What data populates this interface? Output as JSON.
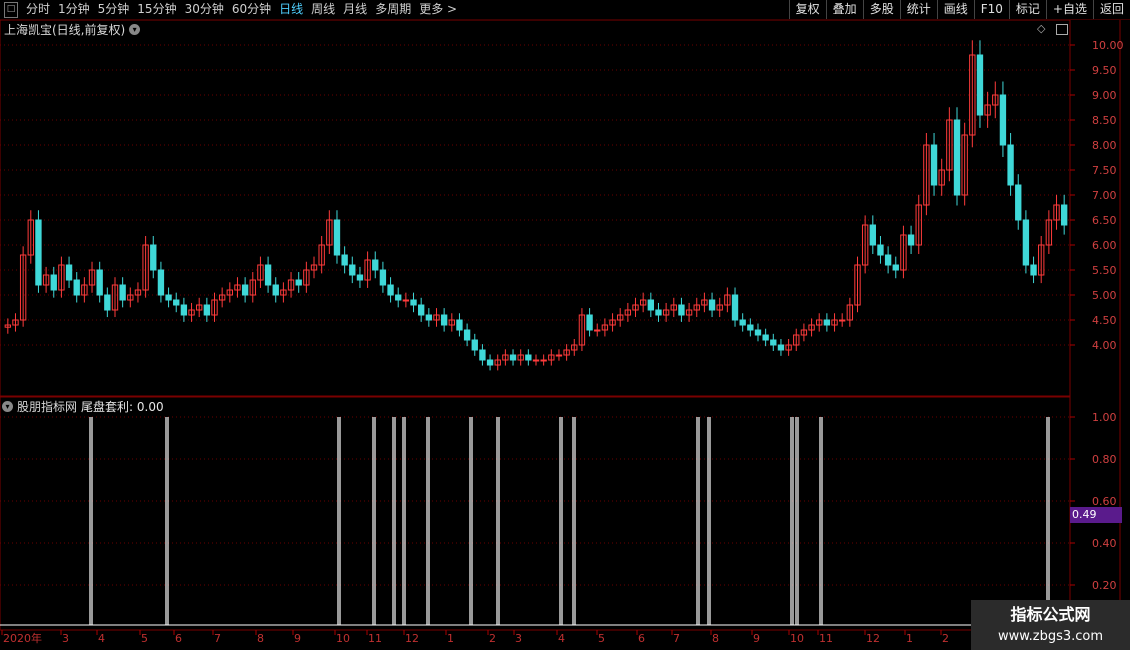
{
  "toolbar": {
    "periods": [
      "分时",
      "1分钟",
      "5分钟",
      "15分钟",
      "30分钟",
      "60分钟",
      "日线",
      "周线",
      "月线",
      "多周期",
      "更多 >"
    ],
    "active_period": "日线",
    "right_buttons": [
      "复权",
      "叠加",
      "多股",
      "统计",
      "画线",
      "F10",
      "标记",
      "+自选",
      "返回"
    ]
  },
  "price_panel": {
    "title": "上海凯宝(日线,前复权)",
    "y_ticks": [
      "10.00",
      "9.50",
      "9.00",
      "8.50",
      "8.00",
      "7.50",
      "7.00",
      "6.50",
      "6.00",
      "5.50",
      "5.00",
      "4.50",
      "4.00"
    ]
  },
  "indicator_panel": {
    "name": "股朋指标网",
    "formula_label": "尾盘套利: 0.00",
    "y_ticks": [
      "1.00",
      "0.80",
      "0.60",
      "0.40",
      "0.20"
    ],
    "current_value": "0.49"
  },
  "date_axis": {
    "labels": [
      "2020年",
      "3",
      "4",
      "5",
      "6",
      "7",
      "8",
      "9",
      "10",
      "11",
      "12",
      "1",
      "2",
      "3",
      "4",
      "5",
      "6",
      "7",
      "8",
      "9",
      "10",
      "11",
      "12",
      "1",
      "2"
    ]
  },
  "watermark": {
    "line1": "指标公式网",
    "line2": "www.zbgs3.com"
  },
  "chart_data": {
    "type": "candlestick",
    "title": "上海凯宝(日线,前复权)",
    "ylim": [
      3.5,
      10.1
    ],
    "close_series": [
      4.4,
      4.5,
      5.8,
      6.5,
      5.2,
      5.4,
      5.1,
      5.6,
      5.3,
      5.0,
      5.2,
      5.5,
      5.0,
      4.7,
      5.2,
      4.9,
      5.0,
      5.1,
      6.0,
      5.5,
      5.0,
      4.9,
      4.8,
      4.6,
      4.7,
      4.8,
      4.6,
      4.9,
      5.0,
      5.1,
      5.2,
      5.0,
      5.3,
      5.6,
      5.2,
      5.0,
      5.1,
      5.3,
      5.2,
      5.5,
      5.6,
      6.0,
      6.5,
      5.8,
      5.6,
      5.4,
      5.3,
      5.7,
      5.5,
      5.2,
      5.0,
      4.9,
      4.9,
      4.8,
      4.6,
      4.5,
      4.6,
      4.4,
      4.5,
      4.3,
      4.1,
      3.9,
      3.7,
      3.6,
      3.7,
      3.8,
      3.7,
      3.8,
      3.7,
      3.7,
      3.7,
      3.8,
      3.8,
      3.9,
      4.0,
      4.6,
      4.3,
      4.3,
      4.4,
      4.5,
      4.6,
      4.7,
      4.8,
      4.9,
      4.7,
      4.6,
      4.7,
      4.8,
      4.6,
      4.7,
      4.8,
      4.9,
      4.7,
      4.8,
      5.0,
      4.5,
      4.4,
      4.3,
      4.2,
      4.1,
      4.0,
      3.9,
      4.0,
      4.2,
      4.3,
      4.4,
      4.5,
      4.4,
      4.5,
      4.5,
      4.8,
      5.6,
      6.4,
      6.0,
      5.8,
      5.6,
      5.5,
      6.2,
      6.0,
      6.8,
      8.0,
      7.2,
      7.5,
      8.5,
      7.0,
      8.2,
      9.8,
      8.6,
      8.8,
      9.0,
      8.0,
      7.2,
      6.5,
      5.6,
      5.4,
      6.0,
      6.5,
      6.8,
      6.4
    ]
  },
  "indicator_chart_data": {
    "type": "bar",
    "ylim": [
      0,
      1
    ],
    "spike_positions_index": [
      17,
      32,
      65,
      72,
      76,
      79,
      83,
      92,
      97,
      110,
      112,
      137,
      139,
      156,
      157,
      159,
      162,
      205
    ],
    "spike_value": 1.0
  }
}
